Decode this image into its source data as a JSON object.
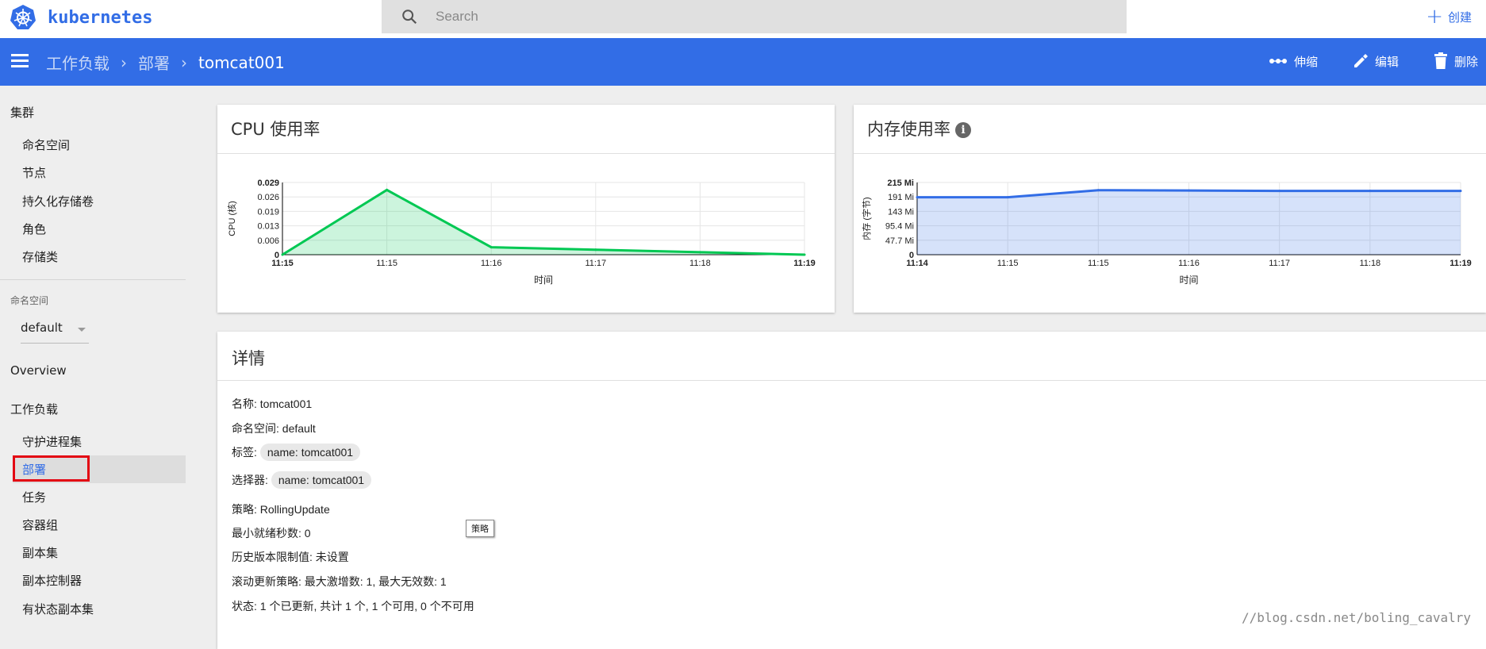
{
  "app": {
    "brand": "kubernetes"
  },
  "search": {
    "placeholder": "Search"
  },
  "topbar": {
    "create_label": "创建"
  },
  "breadcrumb": {
    "items": [
      "工作负载",
      "部署"
    ],
    "current": "tomcat001"
  },
  "actions": {
    "scale": "伸缩",
    "edit": "编辑",
    "delete": "删除"
  },
  "sidebar": {
    "cluster_title": "集群",
    "cluster_items": [
      "命名空间",
      "节点",
      "持久化存储卷",
      "角色",
      "存储类"
    ],
    "namespace_label": "命名空间",
    "namespace_value": "default",
    "overview": "Overview",
    "workloads_title": "工作负载",
    "workload_items": [
      "守护进程集",
      "部署",
      "任务",
      "容器组",
      "副本集",
      "副本控制器",
      "有状态副本集"
    ],
    "active_item": "部署"
  },
  "cpu_card": {
    "title": "CPU 使用率"
  },
  "mem_card": {
    "title": "内存使用率",
    "info_icon": "info-icon"
  },
  "chart_data": [
    {
      "type": "area",
      "title": "CPU 使用率",
      "xlabel": "时间",
      "ylabel": "CPU (核)",
      "x": [
        "11:15",
        "11:15",
        "11:16",
        "11:17",
        "11:18",
        "11:19"
      ],
      "y_ticks": [
        "0",
        "0.006",
        "0.013",
        "0.019",
        "0.026",
        "0.029"
      ],
      "ylim": [
        0,
        0.029
      ],
      "series": [
        {
          "values": [
            0,
            0.026,
            0.003,
            0.002,
            0.001,
            0
          ]
        }
      ],
      "color": "#00c853"
    },
    {
      "type": "area",
      "title": "内存使用率",
      "xlabel": "时间",
      "ylabel": "内存 (字节)",
      "x": [
        "11:14",
        "11:15",
        "11:15",
        "11:16",
        "11:17",
        "11:18",
        "11:19"
      ],
      "y_ticks": [
        "0",
        "47.7 Mi",
        "95.4 Mi",
        "143 Mi",
        "191 Mi",
        "215 Mi"
      ],
      "ylim": [
        0,
        215
      ],
      "series": [
        {
          "values": [
            171,
            171,
            192,
            191,
            190,
            190,
            190
          ]
        }
      ],
      "color": "#326de6"
    }
  ],
  "details": {
    "title": "详情",
    "name_label": "名称:",
    "name_value": "tomcat001",
    "ns_label": "命名空间:",
    "ns_value": "default",
    "labels_label": "标签:",
    "labels_chip": "name: tomcat001",
    "selector_label": "选择器:",
    "selector_chip": "name: tomcat001",
    "strategy_label": "策略:",
    "strategy_value": "RollingUpdate",
    "min_ready_label": "最小就绪秒数:",
    "min_ready_value": "0",
    "history_label": "历史版本限制值:",
    "history_value": "未设置",
    "rolling_label": "滚动更新策略:",
    "rolling_value": "最大激增数: 1, 最大无效数: 1",
    "status_label": "状态:",
    "status_value": "1 个已更新, 共计 1 个, 1 个可用, 0 个不可用",
    "tooltip": "策略"
  },
  "watermark": "//blog.csdn.net/boling_cavalry"
}
